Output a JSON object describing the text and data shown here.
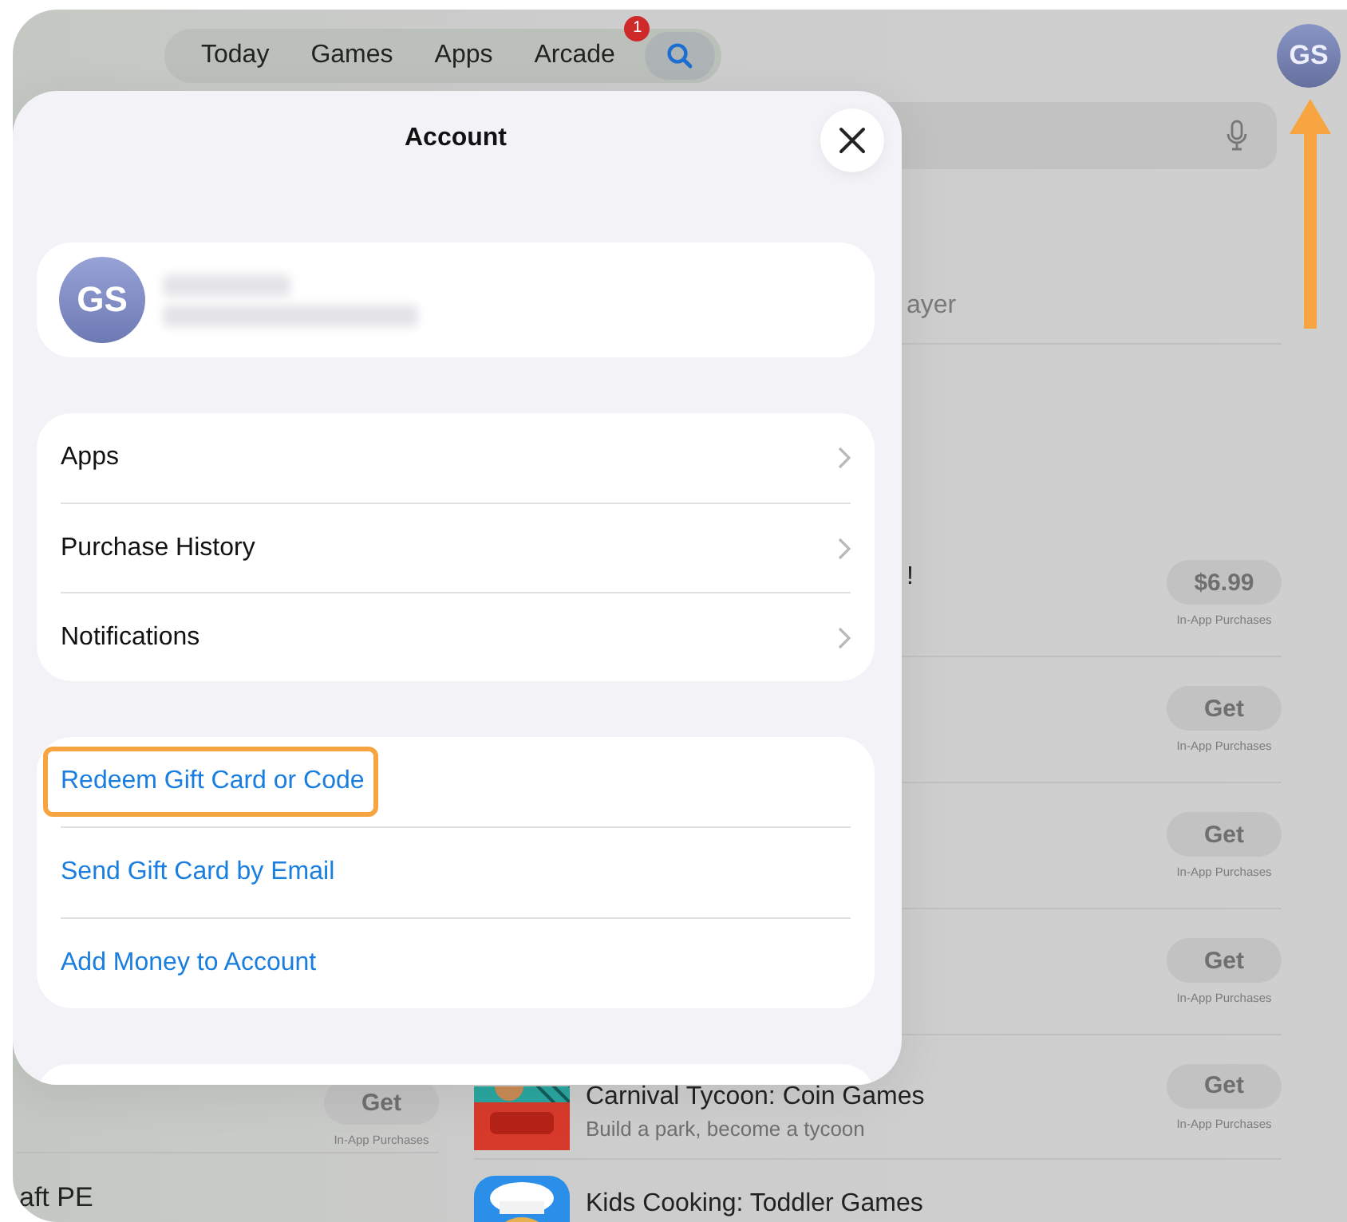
{
  "tab_bar": {
    "tabs": [
      {
        "label": "Today",
        "selected": false
      },
      {
        "label": "Games",
        "selected": false
      },
      {
        "label": "Apps",
        "selected": false
      },
      {
        "label": "Arcade",
        "selected": false,
        "badge": "1"
      }
    ],
    "search_selected": true
  },
  "avatar": {
    "initials": "GS"
  },
  "results": [
    {
      "kind": "covered",
      "subtitle": "ayer"
    },
    {
      "kind": "empty"
    },
    {
      "kind": "covered",
      "title": "!",
      "button": "$6.99",
      "note": "In-App Purchases"
    },
    {
      "kind": "covered",
      "button": "Get",
      "note": "In-App Purchases"
    },
    {
      "kind": "covered",
      "button": "Get",
      "note": "In-App Purchases"
    },
    {
      "kind": "covered",
      "button": "Get",
      "note": "In-App Purchases"
    },
    {
      "kind": "app",
      "title": "Carnival Tycoon: Coin Games",
      "subtitle": "Build a park, become a tycoon",
      "button": "Get",
      "note": "In-App Purchases"
    },
    {
      "kind": "app",
      "title": "Kids Cooking: Toddler Games"
    }
  ],
  "left_results": [
    {
      "kind": "button",
      "button": "Get",
      "note": "In-App Purchases"
    },
    {
      "kind": "title",
      "title": "aft PE"
    }
  ],
  "account_sheet": {
    "title": "Account",
    "profile": {
      "initials": "GS"
    },
    "menu": [
      {
        "label": "Apps"
      },
      {
        "label": "Purchase History"
      },
      {
        "label": "Notifications"
      }
    ],
    "actions": [
      {
        "label": "Redeem Gift Card or Code",
        "highlighted": true
      },
      {
        "label": "Send Gift Card by Email",
        "highlighted": false
      },
      {
        "label": "Add Money to Account",
        "highlighted": false
      }
    ]
  }
}
